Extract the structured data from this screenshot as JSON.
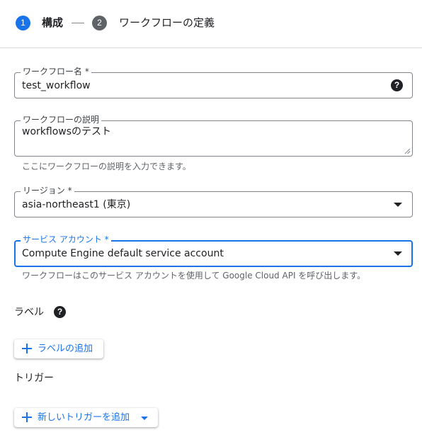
{
  "stepper": {
    "step1": {
      "number": "1",
      "label": "構成"
    },
    "step2": {
      "number": "2",
      "label": "ワークフローの定義"
    }
  },
  "form": {
    "workflow_name": {
      "label": "ワークフロー名 *",
      "value": "test_workflow",
      "help_icon": "question-circle-icon"
    },
    "description": {
      "label": "ワークフローの説明",
      "value": "workflowsのテスト",
      "hint": "ここにワークフローの説明を入力できます。"
    },
    "region": {
      "label": "リージョン *",
      "value": "asia-northeast1 (東京)"
    },
    "service_account": {
      "label": "サービス アカウント *",
      "value": "Compute Engine default service account",
      "hint": "ワークフローはこのサービス アカウントを使用して Google Cloud API を呼び出します。"
    },
    "labels": {
      "title": "ラベル",
      "help_icon": "question-circle-icon",
      "add_button": "ラベルの追加"
    },
    "triggers": {
      "title": "トリガー",
      "add_button": "新しいトリガーを追加"
    }
  },
  "colors": {
    "accent": "#1a73e8",
    "step_inactive": "#5f6368",
    "border": "#80868b",
    "hint_text": "#5f6368"
  }
}
